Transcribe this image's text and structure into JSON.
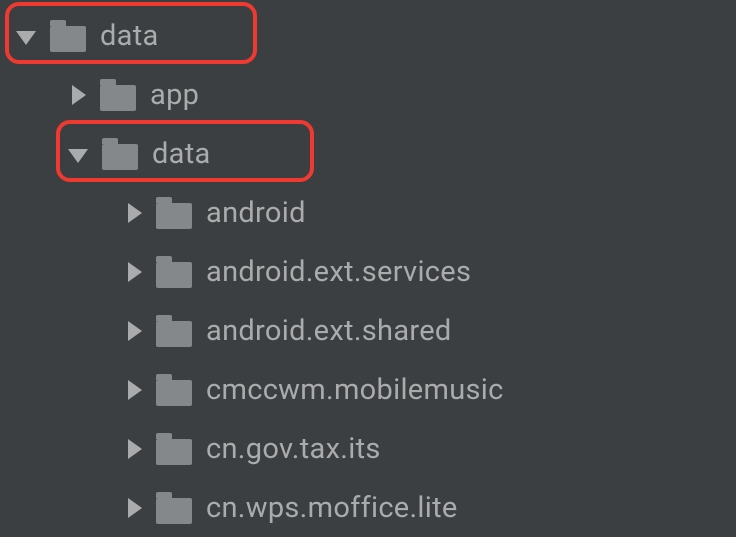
{
  "tree": {
    "root": {
      "label": "data",
      "expanded": true
    },
    "l1_app": {
      "label": "app",
      "expanded": false
    },
    "l1_data": {
      "label": "data",
      "expanded": true
    },
    "l2_items": [
      {
        "label": "android"
      },
      {
        "label": "android.ext.services"
      },
      {
        "label": "android.ext.shared"
      },
      {
        "label": "cmccwm.mobilemusic"
      },
      {
        "label": "cn.gov.tax.its"
      },
      {
        "label": "cn.wps.moffice.lite"
      }
    ]
  }
}
